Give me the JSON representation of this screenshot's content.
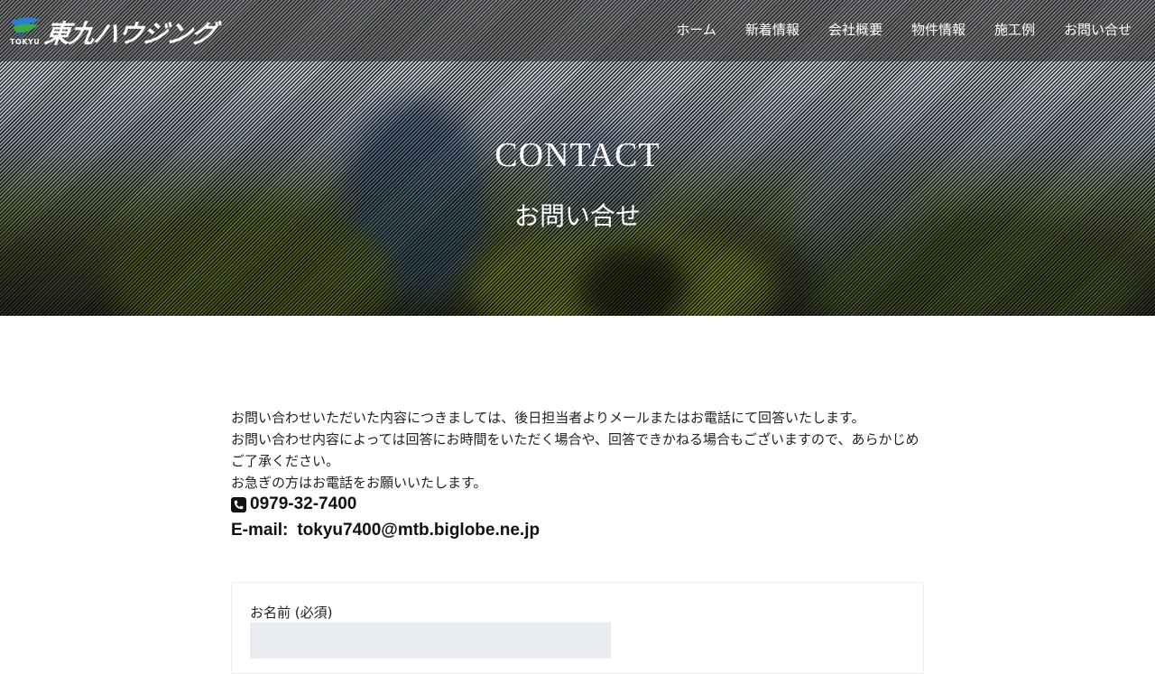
{
  "header": {
    "logo_text": "東九ハウジング",
    "logo_sub": "TOKYU",
    "nav": [
      "ホーム",
      "新着情報",
      "会社概要",
      "物件情報",
      "施工例",
      "お問い合せ"
    ]
  },
  "hero": {
    "title": "CONTACT",
    "subtitle": "お問い合せ"
  },
  "intro": {
    "lines": [
      "お問い合わせいただいた内容につきましては、後日担当者よりメールまたはお電話にて回答いたします。",
      "お問い合わせ内容によっては回答にお時間をいただく場合や、回答できかねる場合もございますので、あらかじめご了承ください。",
      "お急ぎの方はお電話をお願いいたします。"
    ]
  },
  "contact": {
    "phone": "0979-32-7400",
    "email_label": "E-mail:",
    "email": "tokyu7400@mtb.biglobe.ne.jp"
  },
  "form": {
    "name_label": "お名前 (必須)",
    "name_value": ""
  },
  "colors": {
    "header_bg": "#2d2d2d",
    "logo_blue": "#2a7fd4",
    "logo_green": "#3aa845",
    "input_bg": "#e8ebef"
  }
}
